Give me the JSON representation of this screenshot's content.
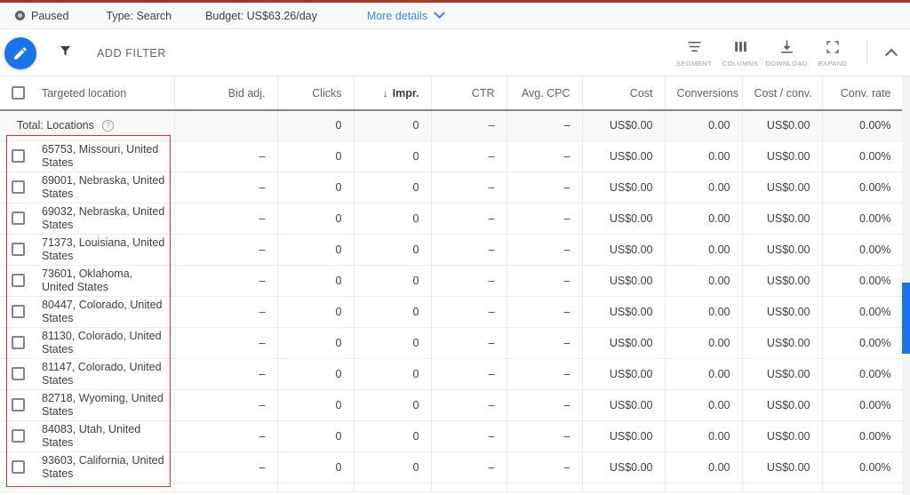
{
  "status_bar": {
    "state_icon": "paused-circle-icon",
    "state": "Paused",
    "type": "Type: Search",
    "budget": "Budget: US$63.26/day",
    "more_details": "More details",
    "chevron_icon": "chevron-down-icon"
  },
  "toolbar": {
    "edit_icon": "pencil-icon",
    "filter_icon": "funnel-icon",
    "add_filter": "ADD FILTER",
    "actions": [
      {
        "icon": "segment-icon",
        "label": "SEGMENT"
      },
      {
        "icon": "columns-icon",
        "label": "COLUMNS"
      },
      {
        "icon": "download-icon",
        "label": "DOWNLOAD"
      },
      {
        "icon": "expand-icon",
        "label": "EXPAND"
      }
    ],
    "collapse_icon": "chevron-up-icon"
  },
  "table": {
    "select_all_checkbox": "unchecked",
    "columns": [
      {
        "key": "location",
        "label": "Targeted location",
        "align": "left",
        "sorted": false
      },
      {
        "key": "bid_adj",
        "label": "Bid adj.",
        "align": "right",
        "sorted": false
      },
      {
        "key": "clicks",
        "label": "Clicks",
        "align": "right",
        "sorted": false
      },
      {
        "key": "impr",
        "label": "Impr.",
        "align": "right",
        "sorted": true,
        "sort_dir": "↓"
      },
      {
        "key": "ctr",
        "label": "CTR",
        "align": "right",
        "sorted": false
      },
      {
        "key": "avg_cpc",
        "label": "Avg. CPC",
        "align": "right",
        "sorted": false
      },
      {
        "key": "cost",
        "label": "Cost",
        "align": "right",
        "sorted": false
      },
      {
        "key": "conv",
        "label": "Conversions",
        "align": "right",
        "sorted": false
      },
      {
        "key": "cost_conv",
        "label": "Cost / conv.",
        "align": "right",
        "sorted": false
      },
      {
        "key": "conv_rate",
        "label": "Conv. rate",
        "align": "right",
        "sorted": false
      }
    ],
    "total_row": {
      "label": "Total: Locations",
      "help_icon": "help-circle-icon",
      "bid_adj": "",
      "clicks": "0",
      "impr": "0",
      "ctr": "–",
      "avg_cpc": "–",
      "cost": "US$0.00",
      "conv": "0.00",
      "cost_conv": "US$0.00",
      "conv_rate": "0.00%"
    },
    "rows": [
      {
        "location": "65753, Missouri, United States",
        "bid_adj": "–",
        "clicks": "0",
        "impr": "0",
        "ctr": "–",
        "avg_cpc": "–",
        "cost": "US$0.00",
        "conv": "0.00",
        "cost_conv": "US$0.00",
        "conv_rate": "0.00%"
      },
      {
        "location": "69001, Nebraska, United States",
        "bid_adj": "–",
        "clicks": "0",
        "impr": "0",
        "ctr": "–",
        "avg_cpc": "–",
        "cost": "US$0.00",
        "conv": "0.00",
        "cost_conv": "US$0.00",
        "conv_rate": "0.00%"
      },
      {
        "location": "69032, Nebraska, United States",
        "bid_adj": "–",
        "clicks": "0",
        "impr": "0",
        "ctr": "–",
        "avg_cpc": "–",
        "cost": "US$0.00",
        "conv": "0.00",
        "cost_conv": "US$0.00",
        "conv_rate": "0.00%"
      },
      {
        "location": "71373, Louisiana, United States",
        "bid_adj": "–",
        "clicks": "0",
        "impr": "0",
        "ctr": "–",
        "avg_cpc": "–",
        "cost": "US$0.00",
        "conv": "0.00",
        "cost_conv": "US$0.00",
        "conv_rate": "0.00%"
      },
      {
        "location": "73601, Oklahoma, United States",
        "bid_adj": "–",
        "clicks": "0",
        "impr": "0",
        "ctr": "–",
        "avg_cpc": "–",
        "cost": "US$0.00",
        "conv": "0.00",
        "cost_conv": "US$0.00",
        "conv_rate": "0.00%"
      },
      {
        "location": "80447, Colorado, United States",
        "bid_adj": "–",
        "clicks": "0",
        "impr": "0",
        "ctr": "–",
        "avg_cpc": "–",
        "cost": "US$0.00",
        "conv": "0.00",
        "cost_conv": "US$0.00",
        "conv_rate": "0.00%"
      },
      {
        "location": "81130, Colorado, United States",
        "bid_adj": "–",
        "clicks": "0",
        "impr": "0",
        "ctr": "–",
        "avg_cpc": "–",
        "cost": "US$0.00",
        "conv": "0.00",
        "cost_conv": "US$0.00",
        "conv_rate": "0.00%"
      },
      {
        "location": "81147, Colorado, United States",
        "bid_adj": "–",
        "clicks": "0",
        "impr": "0",
        "ctr": "–",
        "avg_cpc": "–",
        "cost": "US$0.00",
        "conv": "0.00",
        "cost_conv": "US$0.00",
        "conv_rate": "0.00%"
      },
      {
        "location": "82718, Wyoming, United States",
        "bid_adj": "–",
        "clicks": "0",
        "impr": "0",
        "ctr": "–",
        "avg_cpc": "–",
        "cost": "US$0.00",
        "conv": "0.00",
        "cost_conv": "US$0.00",
        "conv_rate": "0.00%"
      },
      {
        "location": "84083, Utah, United States",
        "bid_adj": "–",
        "clicks": "0",
        "impr": "0",
        "ctr": "–",
        "avg_cpc": "–",
        "cost": "US$0.00",
        "conv": "0.00",
        "cost_conv": "US$0.00",
        "conv_rate": "0.00%"
      },
      {
        "location": "93603, California, United States",
        "bid_adj": "–",
        "clicks": "0",
        "impr": "0",
        "ctr": "–",
        "avg_cpc": "–",
        "cost": "US$0.00",
        "conv": "0.00",
        "cost_conv": "US$0.00",
        "conv_rate": "0.00%"
      }
    ]
  },
  "colors": {
    "accent_blue": "#1a73e8",
    "link_blue": "#4285f4",
    "annotation_red": "#d93025",
    "top_rule_red": "#a33a2a",
    "header_text": "#5f6368"
  }
}
